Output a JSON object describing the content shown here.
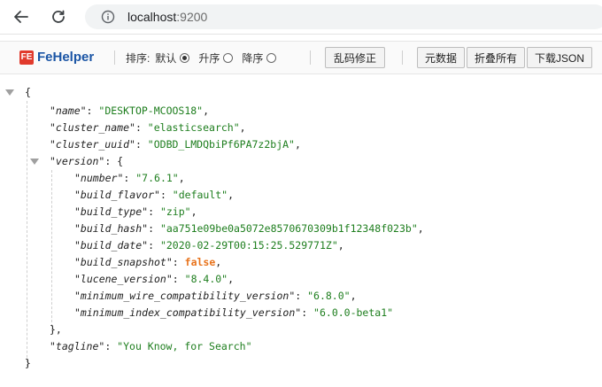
{
  "browser": {
    "url_host": "localhost",
    "url_port": ":9200",
    "back_icon": "back-arrow-icon",
    "reload_icon": "reload-icon",
    "info_icon": "info-icon"
  },
  "toolbar": {
    "logo_mark": "FE",
    "logo_text": "FeHelper",
    "sort_label": "排序:",
    "sort_default": "默认",
    "sort_asc": "升序",
    "sort_desc": "降序",
    "sort_selected": "默认",
    "fix_encoding": "乱码修正",
    "metadata": "元数据",
    "collapse_all": "折叠所有",
    "download_json": "下载JSON"
  },
  "json": {
    "open_brace": "{",
    "close_brace": "}",
    "name_key": "\"name\"",
    "name_val": "\"DESKTOP-MCOOS18\"",
    "cluster_name_key": "\"cluster_name\"",
    "cluster_name_val": "\"elasticsearch\"",
    "cluster_uuid_key": "\"cluster_uuid\"",
    "cluster_uuid_val": "\"ODBD_LMDQbiPf6PA7z2bjA\"",
    "version_key": "\"version\"",
    "number_key": "\"number\"",
    "number_val": "\"7.6.1\"",
    "build_flavor_key": "\"build_flavor\"",
    "build_flavor_val": "\"default\"",
    "build_type_key": "\"build_type\"",
    "build_type_val": "\"zip\"",
    "build_hash_key": "\"build_hash\"",
    "build_hash_val": "\"aa751e09be0a5072e8570670309b1f12348f023b\"",
    "build_date_key": "\"build_date\"",
    "build_date_val": "\"2020-02-29T00:15:25.529771Z\"",
    "build_snapshot_key": "\"build_snapshot\"",
    "build_snapshot_val": "false",
    "lucene_version_key": "\"lucene_version\"",
    "lucene_version_val": "\"8.4.0\"",
    "min_wire_key": "\"minimum_wire_compatibility_version\"",
    "min_wire_val": "\"6.8.0\"",
    "min_index_key": "\"minimum_index_compatibility_version\"",
    "min_index_val": "\"6.0.0-beta1\"",
    "version_close": "},",
    "tagline_key": "\"tagline\"",
    "tagline_val": "\"You Know, for Search\""
  }
}
